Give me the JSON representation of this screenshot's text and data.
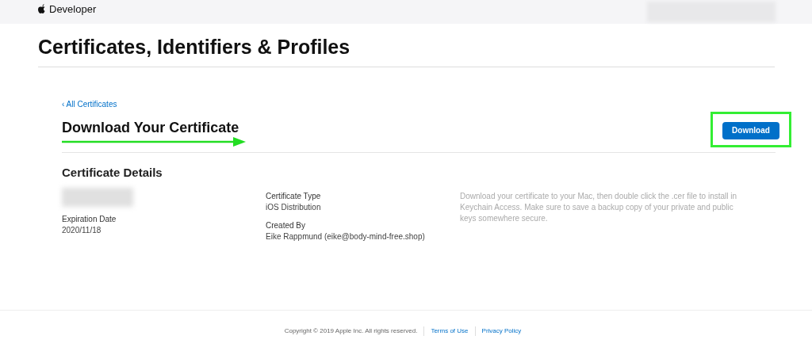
{
  "header": {
    "brand": "Developer"
  },
  "page_title": "Certificates, Identifiers & Profiles",
  "back_link": "‹ All Certificates",
  "heading": "Download Your Certificate",
  "download_button": "Download",
  "details_title": "Certificate Details",
  "details": [
    {
      "label": "Expiration Date",
      "value": "2020/11/18"
    },
    {
      "label": "Certificate Type",
      "value": "iOS Distribution"
    },
    {
      "label": "Created By",
      "value": "Eike Rappmund (eike@body-mind-free.shop)"
    }
  ],
  "note": "Download your certificate to your Mac, then double click the .cer file to install in Keychain Access. Make sure to save a backup copy of your private and public keys somewhere secure.",
  "footer": {
    "copyright": "Copyright © 2019 Apple Inc. All rights reserved.",
    "links": [
      "Terms of Use",
      "Privacy Policy"
    ]
  }
}
